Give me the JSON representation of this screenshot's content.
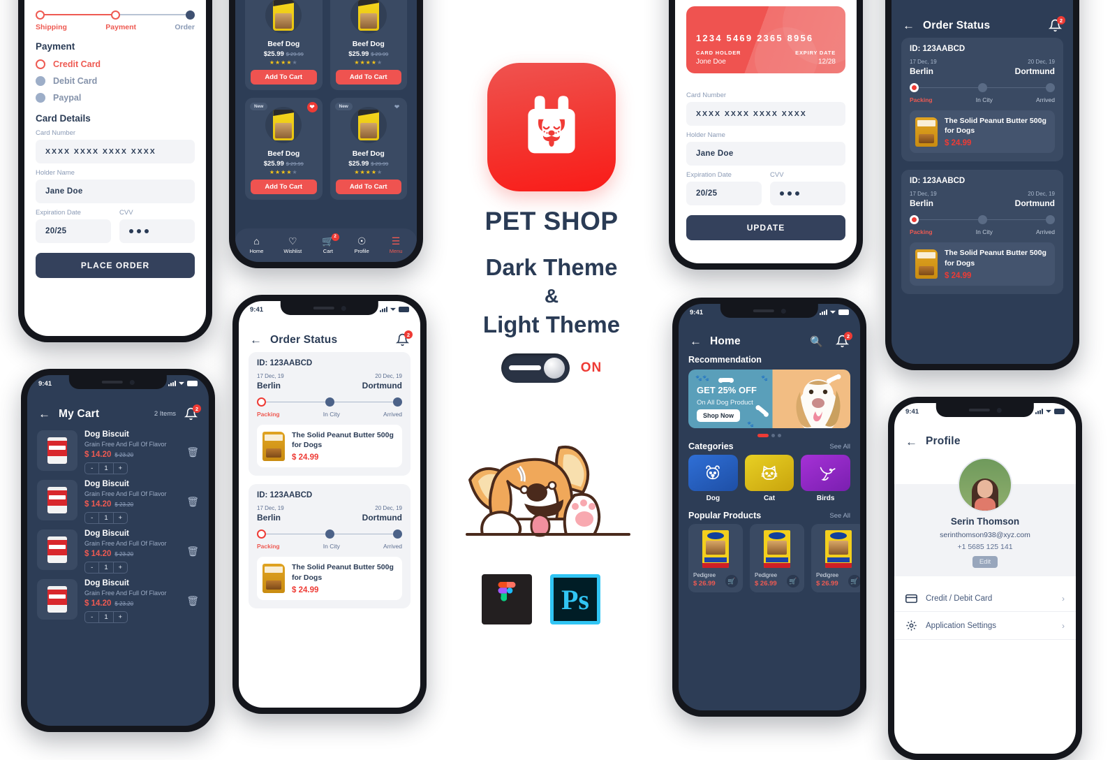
{
  "brand": {
    "app_name": "PET SHOP",
    "line1": "Dark Theme",
    "amp": "&",
    "line2": "Light Theme",
    "toggle_state": "ON",
    "tool_photoshop": "Ps",
    "accent_red": "#ee3b35",
    "dark_navy": "#2a3b55",
    "dark_bg": "#2d3d56",
    "dark_card": "#3a4a63"
  },
  "status_bar": {
    "time": "9:41"
  },
  "payment_screen": {
    "steps": [
      {
        "label": "Shipping",
        "state": "done"
      },
      {
        "label": "Payment",
        "state": "current"
      },
      {
        "label": "Order",
        "state": "pending"
      }
    ],
    "section_payment": "Payment",
    "methods": [
      {
        "label": "Credit Card",
        "selected": true
      },
      {
        "label": "Debit Card",
        "selected": false
      },
      {
        "label": "Paypal",
        "selected": false
      }
    ],
    "section_card_details": "Card Details",
    "fields": {
      "card_number_label": "Card Number",
      "card_number_value": "XXXX  XXXX  XXXX  XXXX",
      "holder_label": "Holder Name",
      "holder_value": "Jane Doe",
      "expiry_label": "Expiration Date",
      "expiry_value": "20/25",
      "cvv_label": "CVV",
      "cvv_value": "•••"
    },
    "cta": "PLACE ORDER"
  },
  "card_update_screen": {
    "card": {
      "number": "1234  5469  2365  8956",
      "holder_caption": "CARD HOLDER",
      "holder_value": "Jone Doe",
      "expiry_caption": "EXPIRY DATE",
      "expiry_value": "12/28"
    },
    "fields": {
      "card_number_label": "Card Number",
      "card_number_value": "XXXX  XXXX  XXXX  XXXX",
      "holder_label": "Holder Name",
      "holder_value": "Jane Doe",
      "expiry_label": "Expiration Date",
      "expiry_value": "20/25",
      "cvv_label": "CVV",
      "cvv_value": "•••"
    },
    "cta": "UPDATE"
  },
  "products_screen": {
    "products": [
      {
        "name": "Beef Dog",
        "price": "$25.99",
        "old_price": "$ 29.99",
        "rating": 4,
        "new": false,
        "fav": false,
        "cta": "Add To Cart"
      },
      {
        "name": "Beef Dog",
        "price": "$25.99",
        "old_price": "$ 29.99",
        "rating": 4,
        "new": false,
        "fav": false,
        "cta": "Add To Cart"
      },
      {
        "name": "Beef Dog",
        "price": "$25.99",
        "old_price": "$ 29.99",
        "rating": 4,
        "new": true,
        "fav": true,
        "cta": "Add To Cart",
        "badge": "New"
      },
      {
        "name": "Beef Dog",
        "price": "$25.99",
        "old_price": "$ 29.99",
        "rating": 4,
        "new": true,
        "fav": false,
        "cta": "Add To Cart",
        "badge": "New"
      }
    ],
    "nav": [
      {
        "label": "Home",
        "icon": "home-icon",
        "active": false
      },
      {
        "label": "Wishlist",
        "icon": "heart-icon",
        "active": false
      },
      {
        "label": "Cart",
        "icon": "cart-icon",
        "active": false,
        "badge": "2"
      },
      {
        "label": "Profile",
        "icon": "user-circle-icon",
        "active": false
      },
      {
        "label": "Menu",
        "icon": "menu-icon",
        "active": true
      }
    ]
  },
  "cart_screen": {
    "title": "My Cart",
    "count": "2 Items",
    "bell_badge": "2",
    "items": [
      {
        "name": "Dog Biscuit",
        "desc": "Grain Free And Full Of Flavor",
        "price": "$ 14.20",
        "old_price": "$ 23.20",
        "qty": "1"
      },
      {
        "name": "Dog Biscuit",
        "desc": "Grain Free And Full Of Flavor",
        "price": "$ 14.20",
        "old_price": "$ 23.20",
        "qty": "1"
      },
      {
        "name": "Dog Biscuit",
        "desc": "Grain Free And Full Of Flavor",
        "price": "$ 14.20",
        "old_price": "$ 23.20",
        "qty": "1"
      },
      {
        "name": "Dog Biscuit",
        "desc": "Grain Free And Full Of Flavor",
        "price": "$ 14.20",
        "old_price": "$ 23.20",
        "qty": "1"
      }
    ]
  },
  "order_status_light": {
    "title": "Order Status",
    "bell_badge": "2",
    "orders": [
      {
        "id": "ID: 123AABCD",
        "from_date": "17 Dec, 19",
        "from_city": "Berlin",
        "to_date": "20 Dec, 19",
        "to_city": "Dortmund",
        "stages": [
          "Packing",
          "In City",
          "Arrived"
        ],
        "product": {
          "name": "The Solid Peanut Butter 500g for Dogs",
          "price": "$ 24.99"
        }
      },
      {
        "id": "ID: 123AABCD",
        "from_date": "17 Dec, 19",
        "from_city": "Berlin",
        "to_date": "20 Dec, 19",
        "to_city": "Dortmund",
        "stages": [
          "Packing",
          "In City",
          "Arrived"
        ],
        "product": {
          "name": "The Solid Peanut Butter 500g for Dogs",
          "price": "$ 24.99"
        }
      }
    ]
  },
  "order_status_dark": {
    "title": "Order Status",
    "bell_badge": "2",
    "orders": [
      {
        "id": "ID: 123AABCD",
        "from_date": "17 Dec, 19",
        "from_city": "Berlin",
        "to_date": "20 Dec, 19",
        "to_city": "Dortmund",
        "stages": [
          "Packing",
          "In City",
          "Arrived"
        ],
        "product": {
          "name": "The Solid Peanut Butter 500g for Dogs",
          "price": "$ 24.99"
        }
      },
      {
        "id": "ID: 123AABCD",
        "from_date": "17 Dec, 19",
        "from_city": "Berlin",
        "to_date": "20 Dec, 19",
        "to_city": "Dortmund",
        "stages": [
          "Packing",
          "In City",
          "Arrived"
        ],
        "product": {
          "name": "The Solid Peanut Butter 500g for Dogs",
          "price": "$ 24.99"
        }
      }
    ]
  },
  "home_screen": {
    "title": "Home",
    "bell_badge": "2",
    "recommendation_label": "Recommendation",
    "banner": {
      "headline": "GET 25% OFF",
      "sub": "On All Dog Product",
      "cta": "Shop Now"
    },
    "categories_label": "Categories",
    "see_all": "See All",
    "categories": [
      {
        "label": "Dog",
        "icon": "dog-icon",
        "color": "#2f6fd6"
      },
      {
        "label": "Cat",
        "icon": "cat-icon",
        "color": "#e0c020"
      },
      {
        "label": "Birds",
        "icon": "bird-icon",
        "color": "#a531d6"
      }
    ],
    "popular_label": "Popular Products",
    "popular": [
      {
        "name": "Pedigree",
        "price": "$ 26.99"
      },
      {
        "name": "Pedigree",
        "price": "$ 26.99"
      },
      {
        "name": "Pedigree",
        "price": "$ 26.99"
      }
    ]
  },
  "profile_screen": {
    "title": "Profile",
    "name": "Serin Thomson",
    "email": "serinthomson938@xyz.com",
    "phone": "+1 5685 125 141",
    "edit": "Edit",
    "items": [
      {
        "label": "Credit / Debit Card",
        "icon": "credit-card-icon"
      },
      {
        "label": "Application Settings",
        "icon": "gear-icon"
      }
    ]
  }
}
